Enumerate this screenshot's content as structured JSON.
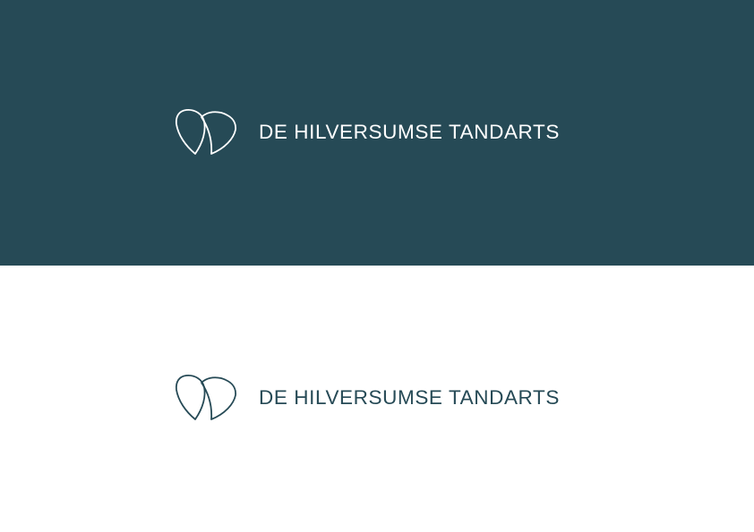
{
  "logo_variants": [
    {
      "variant": "dark-background",
      "background_color": "#264a56",
      "foreground_color": "#ffffff",
      "mark_icon": "tooth-outline-icon",
      "wordmark": "DE HILVERSUMSE TANDARTS"
    },
    {
      "variant": "light-background",
      "background_color": "#ffffff",
      "foreground_color": "#264a56",
      "mark_icon": "tooth-outline-icon",
      "wordmark": "DE HILVERSUMSE TANDARTS"
    }
  ]
}
